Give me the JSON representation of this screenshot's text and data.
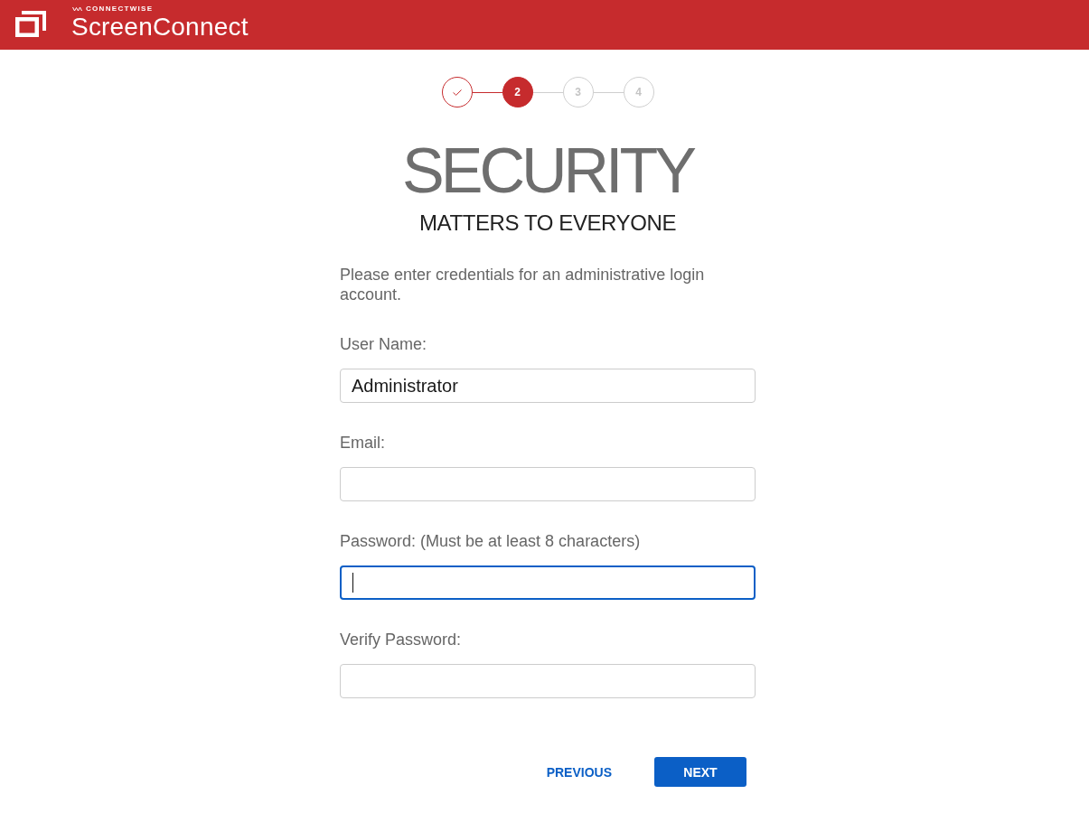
{
  "header": {
    "brand_small": "CONNECTWISE",
    "product": "ScreenConnect"
  },
  "steps": [
    {
      "completed": true,
      "selected": false
    },
    {
      "label": "2",
      "completed": false,
      "selected": true
    },
    {
      "label": "3",
      "completed": false,
      "selected": false
    },
    {
      "label": "4",
      "completed": false,
      "selected": false
    }
  ],
  "heading": "SECURITY",
  "subheading": "MATTERS TO EVERYONE",
  "intro": "Please enter credentials for an administrative login account.",
  "fields": [
    {
      "label": "User Name:",
      "value": "Administrator",
      "focused": false
    },
    {
      "label": "Email:",
      "focused": false
    },
    {
      "label": "Password: (Must be at least 8 characters)",
      "focused": true
    },
    {
      "label": "Verify Password:",
      "focused": false
    }
  ],
  "buttons": [
    {
      "label": "PREVIOUS",
      "kind": "link"
    },
    {
      "label": "NEXT",
      "kind": "primary"
    }
  ]
}
